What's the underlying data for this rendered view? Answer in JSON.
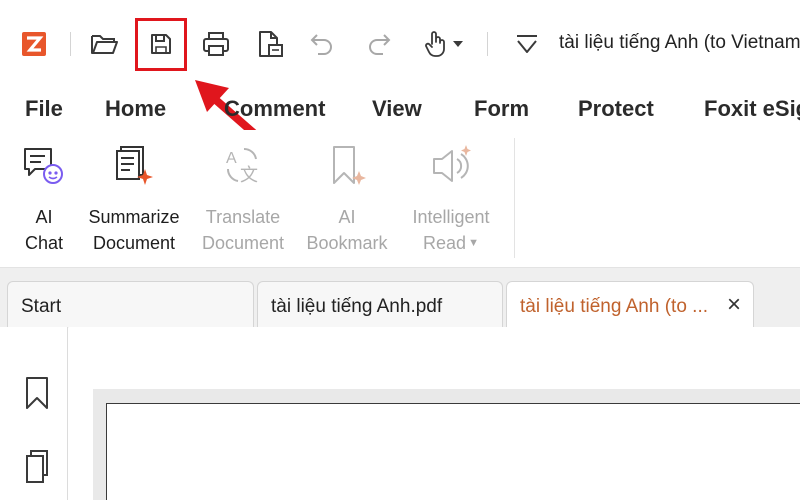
{
  "quick_access": {
    "document_title": "tài liệu tiếng Anh (to Vietnam"
  },
  "menu": {
    "items": [
      "File",
      "Home",
      "Comment",
      "View",
      "Form",
      "Protect",
      "Foxit eSig"
    ]
  },
  "ribbon": {
    "buttons": [
      {
        "line1": "AI",
        "line2": "Chat",
        "enabled": true
      },
      {
        "line1": "Summarize",
        "line2": "Document",
        "enabled": true
      },
      {
        "line1": "Translate",
        "line2": "Document",
        "enabled": false
      },
      {
        "line1": "AI",
        "line2": "Bookmark",
        "enabled": false
      },
      {
        "line1": "Intelligent",
        "line2": "Read",
        "enabled": false
      }
    ]
  },
  "tabs": [
    {
      "label": "Start",
      "active": false
    },
    {
      "label": "tài liệu tiếng Anh.pdf",
      "active": false
    },
    {
      "label": "tài liệu tiếng Anh (to ...",
      "active": true
    }
  ],
  "colors": {
    "highlight": "#e0161d",
    "active_tab_text": "#c0622d",
    "brand": "#e8562b"
  }
}
